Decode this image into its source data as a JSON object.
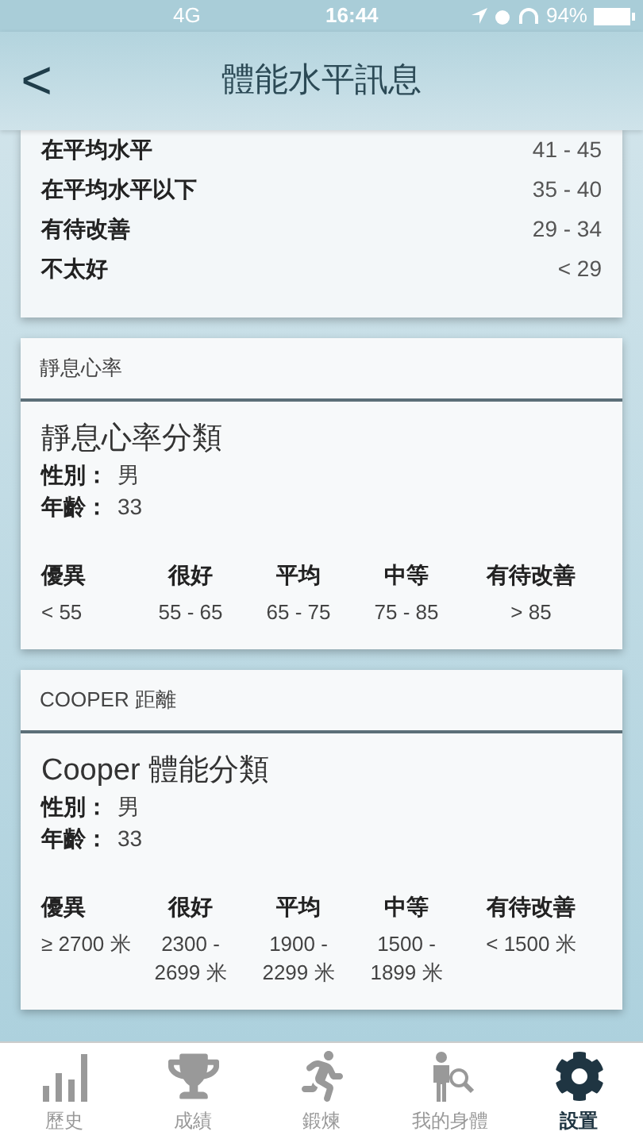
{
  "status_bar": {
    "network": "4G",
    "time": "16:44",
    "battery": "94%"
  },
  "nav": {
    "back": "<",
    "title": "體能水平訊息"
  },
  "partial_card": {
    "rows": [
      {
        "label": "在平均水平",
        "value": "41 - 45"
      },
      {
        "label": "在平均水平以下",
        "value": "35 - 40"
      },
      {
        "label": "有待改善",
        "value": "29 - 34"
      },
      {
        "label": "不太好",
        "value": "< 29"
      }
    ]
  },
  "cards": [
    {
      "header": "靜息心率",
      "title": "靜息心率分類",
      "gender_label": "性別：",
      "gender": "男",
      "age_label": "年齡：",
      "age": "33",
      "columns": [
        {
          "label": "優異",
          "value": "< 55"
        },
        {
          "label": "很好",
          "value": "55 - 65"
        },
        {
          "label": "平均",
          "value": "65 - 75"
        },
        {
          "label": "中等",
          "value": "75 - 85"
        },
        {
          "label": "有待改善",
          "value": "> 85"
        }
      ]
    },
    {
      "header": "COOPER 距離",
      "title": "Cooper 體能分類",
      "gender_label": "性別：",
      "gender": "男",
      "age_label": "年齡：",
      "age": "33",
      "columns": [
        {
          "label": "優異",
          "value": "≥ 2700 米"
        },
        {
          "label": "很好",
          "value": "2300 - 2699 米"
        },
        {
          "label": "平均",
          "value": "1900 - 2299 米"
        },
        {
          "label": "中等",
          "value": "1500 - 1899 米"
        },
        {
          "label": "有待改善",
          "value": "< 1500 米"
        }
      ]
    }
  ],
  "tab_bar": [
    {
      "kind": "history",
      "label": "歷史",
      "selected": false
    },
    {
      "kind": "trophy",
      "label": "成績",
      "selected": false
    },
    {
      "kind": "workout",
      "label": "鍛煉",
      "selected": false
    },
    {
      "kind": "body",
      "label": "我的身體",
      "selected": false
    },
    {
      "kind": "settings",
      "label": "設置",
      "selected": true
    }
  ]
}
